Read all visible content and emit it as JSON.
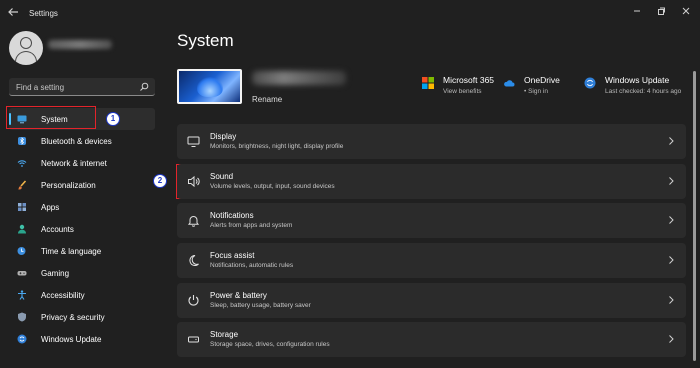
{
  "window": {
    "title": "Settings"
  },
  "user": {
    "name_redacted": true
  },
  "search": {
    "placeholder": "Find a setting"
  },
  "sidebar": {
    "items": [
      {
        "label": "System",
        "icon": "monitor-icon",
        "active": true
      },
      {
        "label": "Bluetooth & devices",
        "icon": "bluetooth-icon"
      },
      {
        "label": "Network & internet",
        "icon": "wifi-icon"
      },
      {
        "label": "Personalization",
        "icon": "brush-icon"
      },
      {
        "label": "Apps",
        "icon": "apps-icon"
      },
      {
        "label": "Accounts",
        "icon": "person-icon"
      },
      {
        "label": "Time & language",
        "icon": "globe-clock-icon"
      },
      {
        "label": "Gaming",
        "icon": "gamepad-icon"
      },
      {
        "label": "Accessibility",
        "icon": "accessibility-icon"
      },
      {
        "label": "Privacy & security",
        "icon": "shield-icon"
      },
      {
        "label": "Windows Update",
        "icon": "update-icon"
      }
    ]
  },
  "annotations": {
    "step1": "1",
    "step2": "2",
    "highlight_color": "#e3242b",
    "badge_color": "#1d36c5"
  },
  "main": {
    "title": "System",
    "device": {
      "rename_label": "Rename"
    },
    "tiles": [
      {
        "title": "Microsoft 365",
        "subtitle": "View benefits",
        "icon": "microsoft-logo-icon"
      },
      {
        "title": "OneDrive",
        "subtitle": "• Sign in",
        "icon": "cloud-icon"
      },
      {
        "title": "Windows Update",
        "subtitle": "Last checked: 4 hours ago",
        "icon": "update-icon"
      }
    ],
    "cards": [
      {
        "title": "Display",
        "subtitle": "Monitors, brightness, night light, display profile",
        "icon": "display-icon"
      },
      {
        "title": "Sound",
        "subtitle": "Volume levels, output, input, sound devices",
        "icon": "speaker-icon"
      },
      {
        "title": "Notifications",
        "subtitle": "Alerts from apps and system",
        "icon": "bell-icon"
      },
      {
        "title": "Focus assist",
        "subtitle": "Notifications, automatic rules",
        "icon": "moon-icon"
      },
      {
        "title": "Power & battery",
        "subtitle": "Sleep, battery usage, battery saver",
        "icon": "power-icon"
      },
      {
        "title": "Storage",
        "subtitle": "Storage space, drives, configuration rules",
        "icon": "storage-icon"
      }
    ]
  },
  "colors": {
    "accent": "#4cc2ff",
    "background": "#202020",
    "card": "#2b2b2b"
  }
}
